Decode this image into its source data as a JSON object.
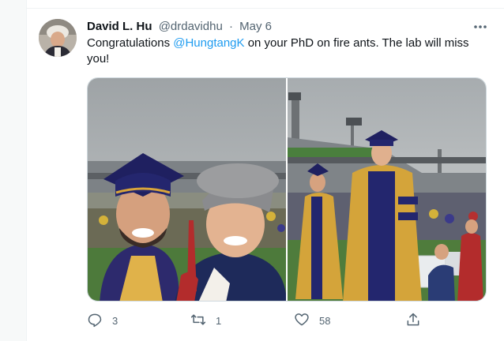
{
  "tweet": {
    "author_name": "David L. Hu",
    "handle": "@drdavidhu",
    "separator": "·",
    "date": "May 6",
    "text_before": "Congratulations ",
    "mention": "@HungtangK",
    "text_after": " on your PhD on fire ants. The lab will miss you!"
  },
  "actions": {
    "reply_count": "3",
    "retweet_count": "1",
    "like_count": "58"
  },
  "icons": {
    "more": "more-icon",
    "reply": "reply-icon",
    "retweet": "retweet-icon",
    "like": "heart-icon",
    "share": "share-icon"
  },
  "colors": {
    "accent": "#1d9bf0",
    "muted": "#536471",
    "text": "#0f1419",
    "border": "#cfd9de"
  }
}
